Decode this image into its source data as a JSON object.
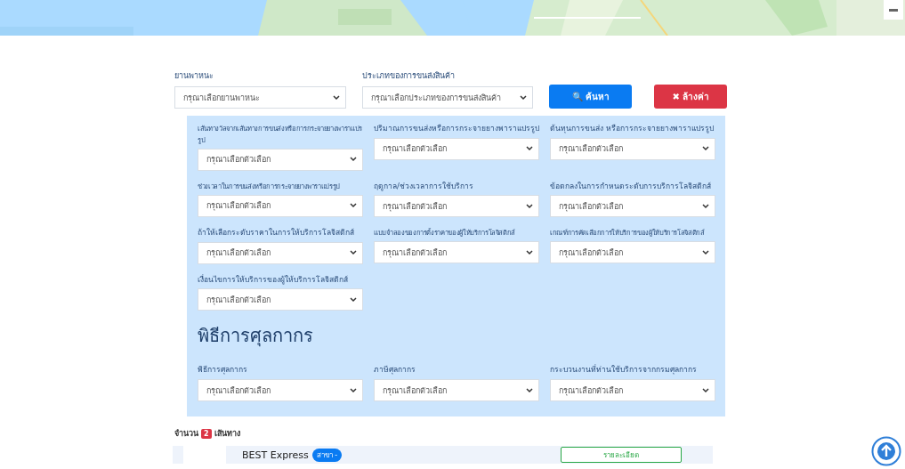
{
  "search": {
    "fields": [
      {
        "label": "ยานพาหนะ",
        "value": "กรุณาเลือกยานพาหนะ"
      },
      {
        "label": "ประเภทของการขนส่งสินค้า",
        "value": "กรุณาเลือกประเภทของการขนส่งสินค้า"
      }
    ],
    "search_button": {
      "icon": "🔍",
      "label": "ค้นหา"
    },
    "clear_button": {
      "icon": "✖",
      "label": "ล้างค่า"
    }
  },
  "filters": [
    {
      "label": "เส้นทางวัลจากเส้นทางการขนส่งหรือการกระจายยางพาราแปรรูป",
      "small": true,
      "value": "กรุณาเลือกตัวเลือก"
    },
    {
      "label": "ปริมาณการขนส่งหรือการกระจายยางพาราแปรรูป",
      "small": false,
      "value": "กรุณาเลือกตัวเลือก"
    },
    {
      "label": "ต้นทุนการขนส่ง หรือการกระจายยางพาราแปรรูป",
      "small": false,
      "value": "กรุณาเลือกตัวเลือก"
    },
    {
      "label": "ช่วงเวลาในการขนส่งหรือการกระจายยางพาราแปรรูป",
      "small": true,
      "value": "กรุณาเลือกตัวเลือก"
    },
    {
      "label": "ฤดูกาล/ช่วงเวลาการใช้บริการ",
      "small": false,
      "value": "กรุณาเลือกตัวเลือก"
    },
    {
      "label": "ข้อตกลงในการกำหนดระดับการบริการโลจิสติกส์",
      "small": false,
      "value": "กรุณาเลือกตัวเลือก"
    },
    {
      "label": "ถ้าให้เลือกระดับราคาในการให้บริการโลจิสติกส์",
      "small": false,
      "value": "กรุณาเลือกตัวเลือก"
    },
    {
      "label": "แบบจำลองของการตั้งราคาของผู้ให้บริการโลจิสติกส์",
      "small": true,
      "value": "กรุณาเลือกตัวเลือก"
    },
    {
      "label": "เกณฑ์การคัดเลือกการให้บริการของผู้ให้บริการโลจิสติกส์",
      "small": true,
      "value": "กรุณาเลือกตัวเลือก"
    },
    {
      "label": "เงื่อนไขการให้บริการของผู้ให้บริการโลจิสติกส์",
      "small": false,
      "value": "กรุณาเลือกตัวเลือก"
    }
  ],
  "customs": {
    "heading": "พิธีการศุลกากร",
    "filters": [
      {
        "label": "พิธีการศุลกากร",
        "small": false,
        "value": "กรุณาเลือกตัวเลือก"
      },
      {
        "label": "ภาษีศุลกากร",
        "small": false,
        "value": "กรุณาเลือกตัวเลือก"
      },
      {
        "label": "กระบวนงานที่ท่านใช้บริการจากกรมศุลกากร",
        "small": false,
        "value": "กรุณาเลือกตัวเลือก"
      }
    ]
  },
  "results": {
    "prefix": "จำนวน",
    "count": "2",
    "suffix": "เส้นทาง",
    "items": [
      {
        "name": "BEST Express",
        "badge": "สาขา -",
        "button": "รายละเอียด"
      }
    ]
  }
}
